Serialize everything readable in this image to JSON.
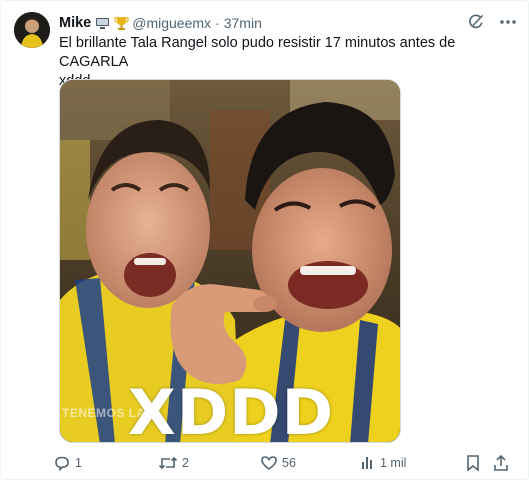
{
  "author": {
    "name": "Mike",
    "handle": "@migueemx",
    "separator": "·",
    "time": "37min",
    "badges": [
      "computer-icon",
      "trophy-icon"
    ]
  },
  "tweet": {
    "line1": "El brillante Tala Rangel solo pudo resistir 17 minutos antes de CAGARLA",
    "line2": "xddd"
  },
  "media": {
    "overlay_text": "XDDD",
    "watermark": "TENEMOS LA"
  },
  "header_icons": [
    "grok-icon",
    "more-icon"
  ],
  "actions": {
    "replies": "1",
    "retweets": "2",
    "likes": "56",
    "views": "1 mil"
  },
  "colors": {
    "text": "#0f1419",
    "muted": "#536471",
    "border": "#cfd9de",
    "jersey_yellow": "#f2d21b"
  }
}
